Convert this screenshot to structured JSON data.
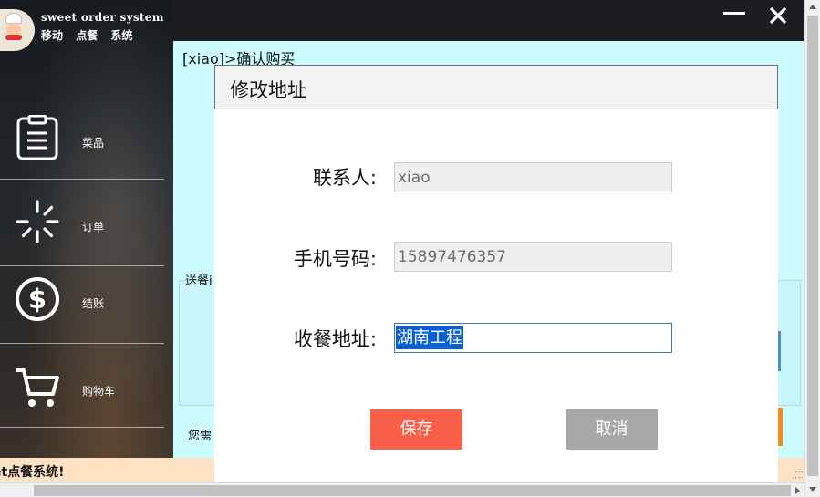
{
  "app": {
    "brand_en": "sweet order system",
    "brand_cn": [
      "移动",
      "点餐",
      "系统"
    ]
  },
  "sidebar": {
    "items": [
      {
        "label": "菜品",
        "icon": "clipboard-list-icon"
      },
      {
        "label": "订单",
        "icon": "loading-spinner-icon"
      },
      {
        "label": "结账",
        "icon": "dollar-coin-icon"
      },
      {
        "label": "购物车",
        "icon": "shopping-cart-icon"
      }
    ]
  },
  "content": {
    "breadcrumb": "[xiao]>确认购买",
    "behind_label_1": "送餐i",
    "behind_label_2": "您需"
  },
  "marquee": {
    "text": "et点餐系统!"
  },
  "dialog": {
    "title": "修改地址",
    "contact_label": "联系人:",
    "contact_value": "xiao",
    "phone_label": "手机号码:",
    "phone_value": "15897476357",
    "address_label": "收餐地址:",
    "address_value": "湖南工程",
    "save_label": "保存",
    "cancel_label": "取消"
  },
  "colors": {
    "content_bg": "#ccfcff",
    "save_button": "#f86049",
    "cancel_button": "#a8a8a8",
    "selection": "#0a5fd6",
    "marquee_bg": "#fde3c4"
  }
}
